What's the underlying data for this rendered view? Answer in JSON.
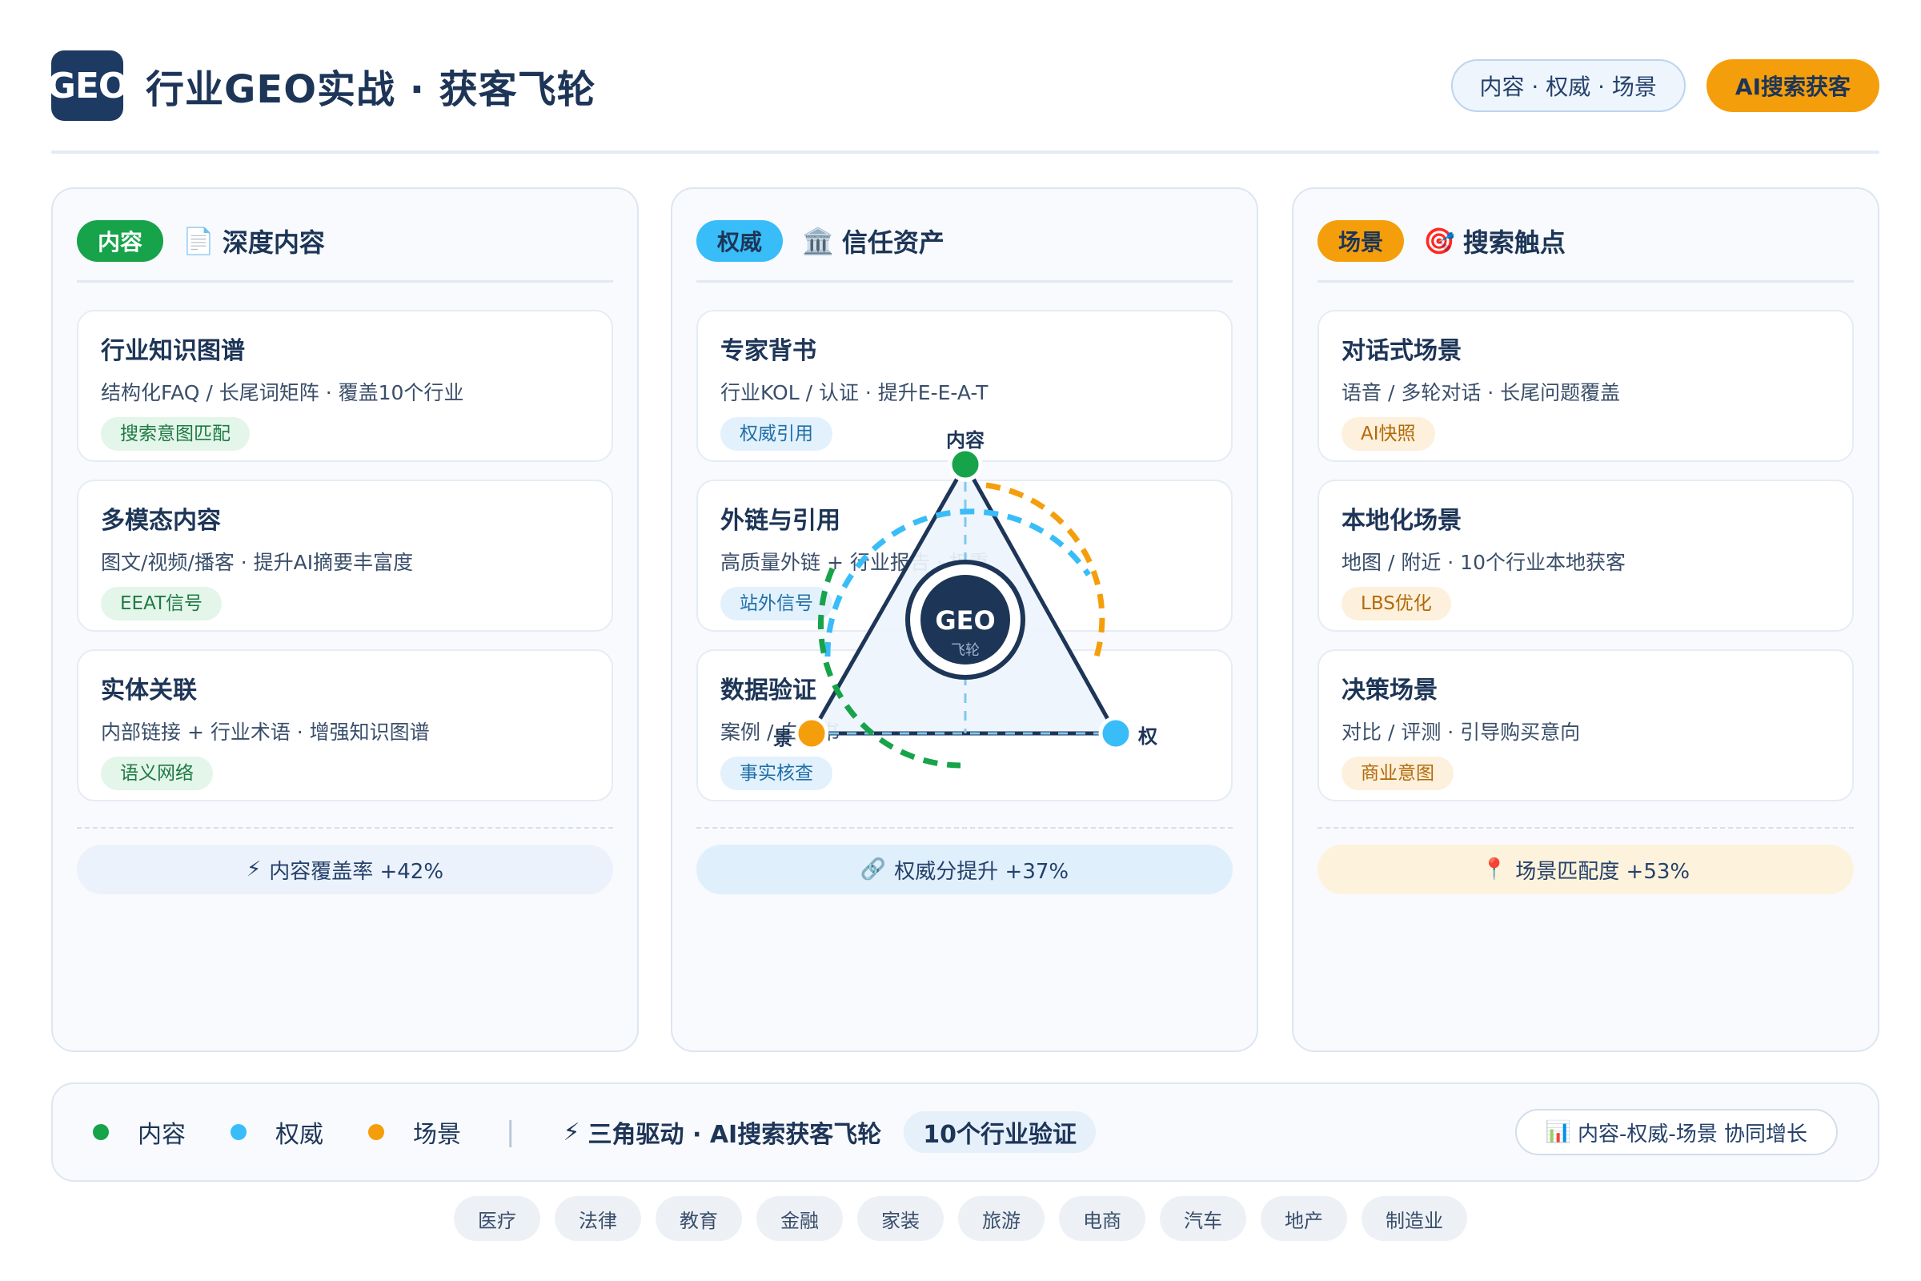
{
  "header": {
    "logo_text": "GEO",
    "title": "行业GEO实战 · 获客飞轮",
    "outline_pill": "内容 · 权威 · 场景",
    "cta": "AI搜索获客"
  },
  "columns": [
    {
      "tag": "内容",
      "tag_color": "#16a34a",
      "icon": "📄",
      "icon_name": "document-icon",
      "title": "深度内容",
      "cards": [
        {
          "title": "行业知识图谱",
          "desc": "结构化FAQ / 长尾词矩阵 · 覆盖10个行业",
          "chip": "搜索意图匹配"
        },
        {
          "title": "多模态内容",
          "desc": "图文/视频/播客 · 提升AI摘要丰富度",
          "chip": "EEAT信号"
        },
        {
          "title": "实体关联",
          "desc": "内部链接 + 行业术语 · 增强知识图谱",
          "chip": "语义网络"
        }
      ],
      "stat_icon": "⚡",
      "stat": "内容覆盖率 +42%"
    },
    {
      "tag": "权威",
      "tag_color": "#38bdf8",
      "icon": "🏛️",
      "icon_name": "institution-icon",
      "title": "信任资产",
      "cards": [
        {
          "title": "专家背书",
          "desc": "行业KOL / 认证 · 提升E-E-A-T",
          "chip": "权威引用"
        },
        {
          "title": "外链与引用",
          "desc": "高质量外链 + 行业报告 · 权重",
          "chip": "站外信号"
        },
        {
          "title": "数据验证",
          "desc": "案例 / 白皮书",
          "chip": "事实核查"
        }
      ],
      "stat_icon": "🔗",
      "stat": "权威分提升 +37%"
    },
    {
      "tag": "场景",
      "tag_color": "#f59e0b",
      "icon": "🎯",
      "icon_name": "target-icon",
      "title": "搜索触点",
      "cards": [
        {
          "title": "对话式场景",
          "desc": "语音 / 多轮对话 · 长尾问题覆盖",
          "chip": "AI快照"
        },
        {
          "title": "本地化场景",
          "desc": "地图 / 附近 · 10个行业本地获客",
          "chip": "LBS优化"
        },
        {
          "title": "决策场景",
          "desc": "对比 / 评测 · 引导购买意向",
          "chip": "商业意图"
        }
      ],
      "stat_icon": "📍",
      "stat": "场景匹配度 +53%"
    }
  ],
  "flywheel": {
    "center_text": "GEO",
    "center_sub": "飞轮",
    "node_top": "内容",
    "node_right": "权",
    "node_left": "景",
    "colors": {
      "content": "#16a34a",
      "authority": "#38bdf8",
      "scene": "#f59e0b",
      "edge": "#1d3557"
    }
  },
  "legend": {
    "items": [
      {
        "label": "内容",
        "color": "#16a34a"
      },
      {
        "label": "权威",
        "color": "#38bdf8"
      },
      {
        "label": "场景",
        "color": "#f59e0b"
      }
    ],
    "separator": "|",
    "bolt": "⚡",
    "slogan": "三角驱动 · AI搜索获客飞轮",
    "badge": "10个行业验证",
    "right_icon": "📊",
    "right_text": "内容-权威-场景 协同增长"
  },
  "industries": [
    "医疗",
    "法律",
    "教育",
    "金融",
    "家装",
    "旅游",
    "电商",
    "汽车",
    "地产",
    "制造业"
  ]
}
